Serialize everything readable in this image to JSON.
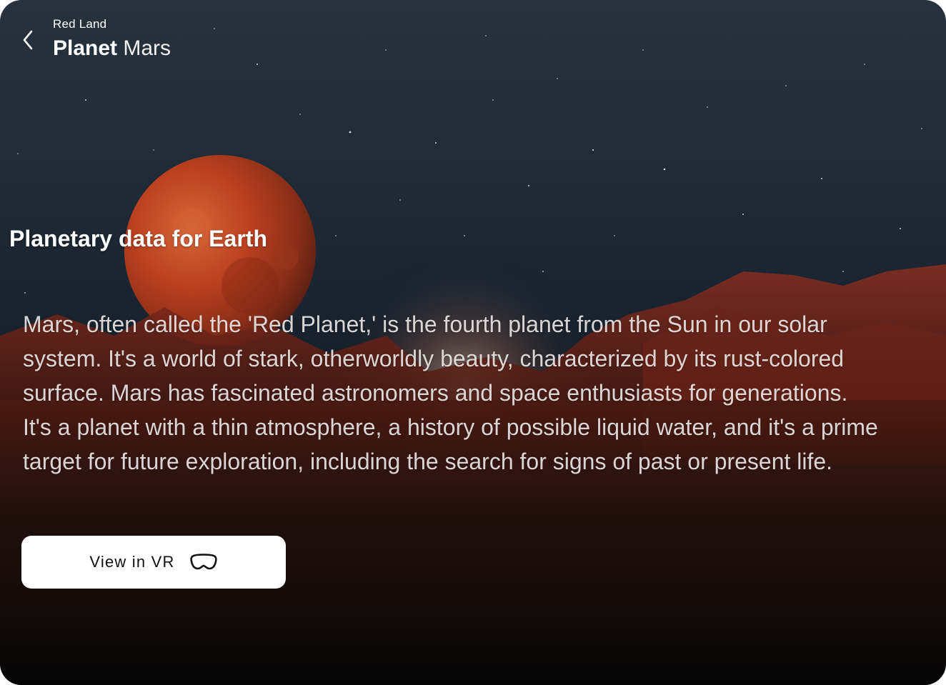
{
  "header": {
    "back_icon": "chevron-left-icon",
    "subtitle": "Red Land",
    "title_bold": "Planet",
    "title_light": "Mars"
  },
  "section": {
    "title": "Planetary data for Earth"
  },
  "description": {
    "text": "Mars, often called the 'Red Planet,' is the fourth planet from the Sun in our solar system. It's a world of stark, otherworldly beauty, characterized by its rust-colored surface. Mars has fascinated astronomers and space enthusiasts for generations. It's a planet with a thin atmosphere, a history of possible liquid water, and it's a prime target for future exploration, including the search for signs of past or present life."
  },
  "vr_button": {
    "label": "View in VR",
    "icon": "vr-headset-icon"
  },
  "colors": {
    "sky_top": "#26333f",
    "mars_red": "#c2411e",
    "terrain_red": "#7a2a1c",
    "button_bg": "#ffffff",
    "text_white": "#ffffff"
  }
}
